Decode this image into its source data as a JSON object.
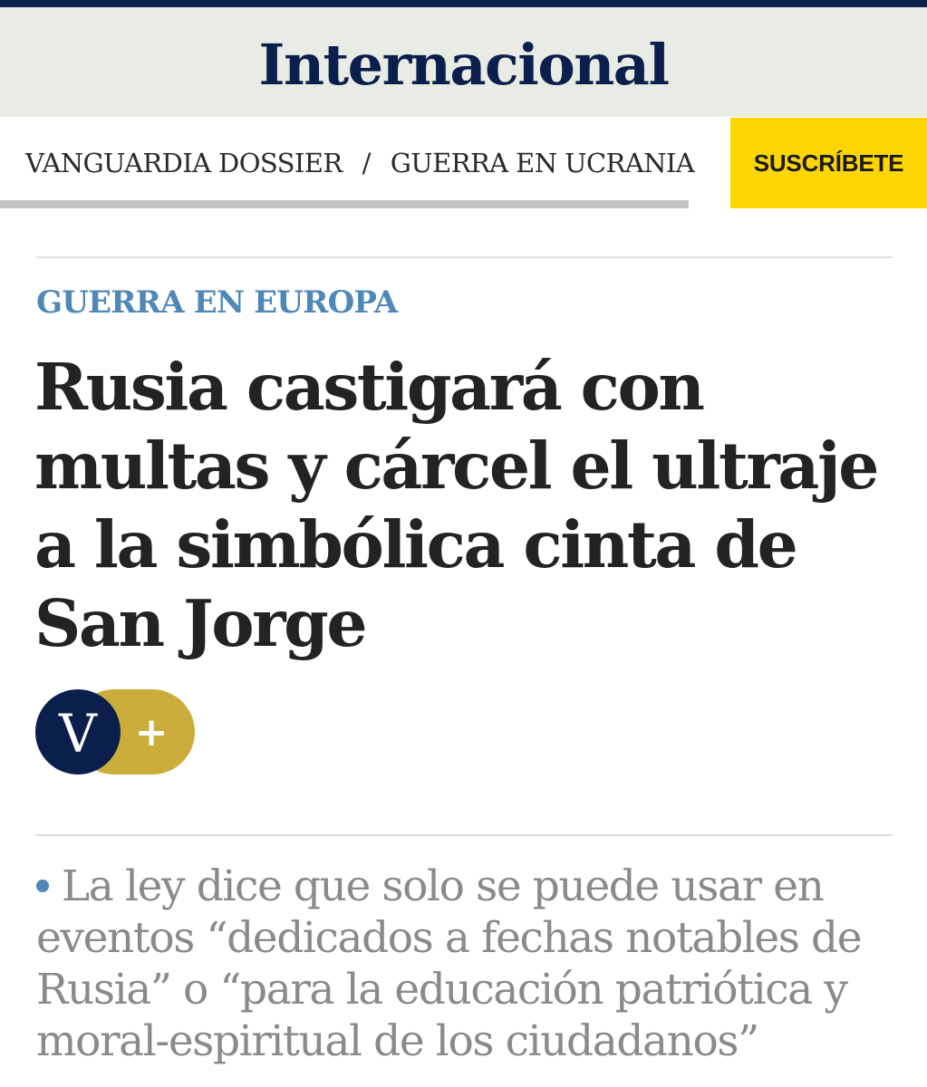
{
  "header": {
    "section_title": "Internacional"
  },
  "subnav": {
    "items": [
      "VANGUARDIA DOSSIER",
      "GUERRA EN UCRANIA"
    ],
    "separator": "/",
    "subscribe_label": "SUSCRÍBETE"
  },
  "article": {
    "kicker": "GUERRA EN EUROPA",
    "headline": "Rusia castigará con multas y cárcel el ultraje a la simbólica cinta de San Jorge",
    "badge": {
      "letter": "V",
      "plus": "+"
    },
    "summary": "La ley dice que solo se puede usar en eventos “dedicados a fechas notables de Rusia” o “para la educación patriótica y moral-espiritual de los ciudadanos”"
  },
  "colors": {
    "brand_navy": "#0b1f4d",
    "header_bg": "#e9ece4",
    "subscribe_yellow": "#fdd500",
    "kicker_blue": "#4f87b6",
    "badge_gold": "#ccac3a"
  }
}
